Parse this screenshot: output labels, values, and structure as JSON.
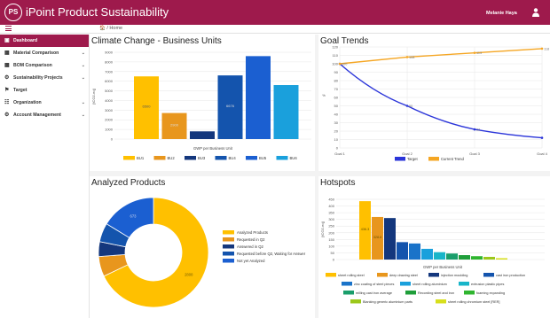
{
  "app": {
    "logo_text": "PS",
    "title": "iPoint Product Sustainability",
    "user": "Melanie Haya",
    "breadcrumb": "🏠 / Home"
  },
  "colors": {
    "brand": "#9e1a4c",
    "bu1": "#ffc000",
    "bu2": "#e8961d",
    "bu3": "#14377d",
    "bu4": "#1454ad",
    "bu5": "#1b5fd1",
    "bu6": "#1aa0dc",
    "target": "#2b35d9",
    "current": "#f5a623"
  },
  "sidebar": {
    "items": [
      {
        "label": "Dashboard",
        "icon": "dashboard-icon",
        "glyph": "▣",
        "active": true,
        "chevron": false
      },
      {
        "label": "Material Comparison",
        "icon": "material-icon",
        "glyph": "▦",
        "active": false,
        "chevron": true
      },
      {
        "label": "BOM Comparison",
        "icon": "bom-icon",
        "glyph": "▦",
        "active": false,
        "chevron": true
      },
      {
        "label": "Sustainability Projects",
        "icon": "projects-icon",
        "glyph": "⚙",
        "active": false,
        "chevron": true
      },
      {
        "label": "Target",
        "icon": "flag-icon",
        "glyph": "⚑",
        "active": false,
        "chevron": false
      },
      {
        "label": "Organization",
        "icon": "organization-icon",
        "glyph": "☷",
        "active": false,
        "chevron": true
      },
      {
        "label": "Account Management",
        "icon": "account-icon",
        "glyph": "⚙",
        "active": false,
        "chevron": true
      }
    ]
  },
  "panels": {
    "climate": {
      "title": "Climate Change - Business Units"
    },
    "goals": {
      "title": "Goal Trends"
    },
    "analyzed": {
      "title": "Analyzed Products"
    },
    "hotspots": {
      "title": "Hotspots"
    }
  },
  "chart_data": [
    {
      "type": "bar",
      "title": "Climate Change - Business Units",
      "xlabel": "GWP per Business Unit",
      "ylabel": "[tCO2-eq]",
      "ylim": [
        0,
        9000
      ],
      "yticks": [
        0,
        1000,
        2000,
        3000,
        4000,
        5000,
        6000,
        7000,
        8000,
        9000
      ],
      "categories": [
        "BU1",
        "BU2",
        "BU3",
        "BU4",
        "BU5",
        "BU6"
      ],
      "values": [
        6500,
        2700,
        800,
        6600,
        8600,
        5600
      ],
      "value_labels": [
        "6500",
        "2900",
        "",
        "6676",
        "",
        ""
      ],
      "legend": [
        "BU1",
        "BU2",
        "BU3",
        "BU4",
        "BU5",
        "BU6"
      ],
      "legend_position": "bottom",
      "grid": true
    },
    {
      "type": "line",
      "title": "Goal Trends",
      "ylabel": "%",
      "ylim": [
        0,
        120
      ],
      "yticks": [
        0,
        10,
        20,
        30,
        40,
        50,
        60,
        70,
        80,
        90,
        100,
        110,
        120
      ],
      "x": [
        "Goal 1",
        "Goal 2",
        "Goal 3",
        "Goal 4"
      ],
      "series": [
        {
          "name": "Target",
          "values": [
            100,
            50,
            22,
            12
          ]
        },
        {
          "name": "Current Trend",
          "values": [
            100,
            108,
            113,
            118
          ]
        }
      ],
      "point_labels": {
        "Target": [
          "",
          "50",
          "22",
          ""
        ],
        "Current Trend": [
          "100",
          "108",
          "113",
          "118"
        ]
      },
      "legend_position": "bottom",
      "grid": true
    },
    {
      "type": "pie",
      "title": "Analyzed Products",
      "donut": true,
      "labels": [
        "Analyzed Products",
        "Requested in Q2",
        "Answered in Q2",
        "Requested before Q2, Waiting for Answer",
        "Not yet Analyzed"
      ],
      "values": [
        2808,
        245,
        180,
        230,
        673
      ],
      "slice_labels": [
        "2808",
        "",
        "",
        "",
        "673"
      ],
      "legend_position": "right"
    },
    {
      "type": "bar",
      "title": "Hotspots",
      "xlabel": "GWP per Business Unit",
      "ylabel": "[tCO2-eq]",
      "ylim": [
        0,
        450
      ],
      "yticks": [
        0,
        50,
        100,
        150,
        200,
        250,
        300,
        350,
        400,
        450
      ],
      "categories": [
        "sheet rolling steel",
        "deep drawing steel",
        "injection moulding",
        "cast iron production",
        "zinc coating of steel pieces",
        "sheet rolling aluminium",
        "extrusion plastic pipes",
        "milling cast iron average",
        "Recording steel and iron",
        "foaming expanding",
        "Blanking generic aluminium parts",
        "sheet rolling chromium steel [RER]"
      ],
      "values": [
        436,
        318,
        310,
        130,
        120,
        80,
        55,
        45,
        33,
        25,
        20,
        10
      ],
      "value_labels": [
        "436.3",
        "328.8",
        "",
        "",
        "",
        "",
        "",
        "",
        "",
        "",
        "",
        ""
      ],
      "legend_position": "bottom",
      "grid": true
    }
  ]
}
